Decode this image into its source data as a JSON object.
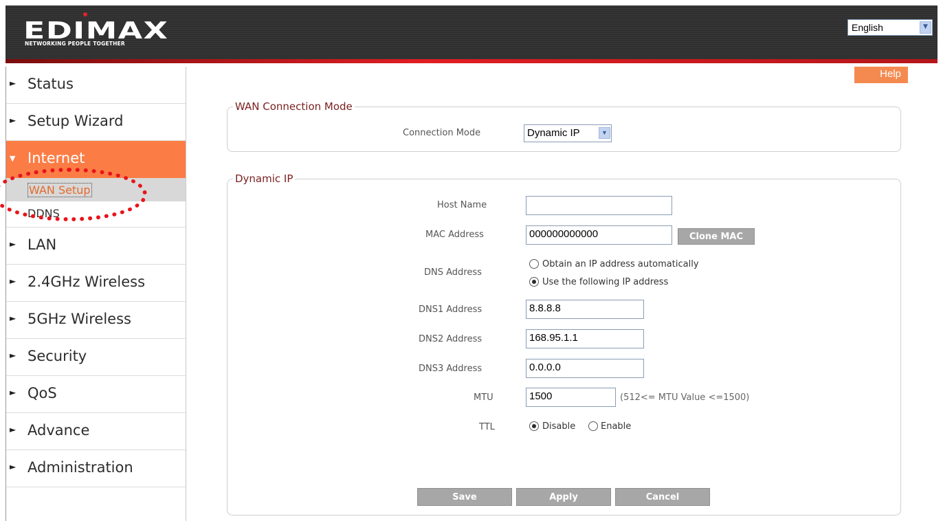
{
  "header": {
    "logo_text": "EDIMAX",
    "logo_tagline": "NETWORKING PEOPLE TOGETHER",
    "language": "English"
  },
  "sidebar": {
    "items": [
      {
        "label": "Status"
      },
      {
        "label": "Setup Wizard"
      },
      {
        "label": "Internet"
      },
      {
        "label": "LAN"
      },
      {
        "label": "2.4GHz Wireless"
      },
      {
        "label": "5GHz Wireless"
      },
      {
        "label": "Security"
      },
      {
        "label": "QoS"
      },
      {
        "label": "Advance"
      },
      {
        "label": "Administration"
      }
    ],
    "sub_items": [
      {
        "label": "WAN Setup"
      },
      {
        "label": "DDNS"
      }
    ]
  },
  "help_label": "Help",
  "wan_mode": {
    "title": "WAN  Connection Mode",
    "connection_mode_label": "Connection Mode",
    "connection_mode_value": "Dynamic IP"
  },
  "dynamic_ip": {
    "title": "Dynamic IP",
    "host_name_label": "Host Name",
    "host_name_value": "",
    "mac_label": "MAC Address",
    "mac_value": "000000000000",
    "clone_mac_label": "Clone MAC",
    "dns_label": "DNS  Address",
    "dns_auto_label": "Obtain an IP address automatically",
    "dns_manual_label": "Use the following IP address",
    "dns1_label": "DNS1  Address",
    "dns1_value": "8.8.8.8",
    "dns2_label": "DNS2  Address",
    "dns2_value": "168.95.1.1",
    "dns3_label": "DNS3  Address",
    "dns3_value": "0.0.0.0",
    "mtu_label": "MTU",
    "mtu_value": "1500",
    "mtu_hint": "(512<= MTU  Value <=1500)",
    "ttl_label": "TTL",
    "ttl_disable_label": "Disable",
    "ttl_enable_label": "Enable"
  },
  "actions": {
    "save_label": "Save",
    "apply_label": "Apply",
    "cancel_label": "Cancel"
  },
  "colors": {
    "accent": "#fb7d45",
    "header_bg": "#333333",
    "highlight": "#e8141b"
  }
}
